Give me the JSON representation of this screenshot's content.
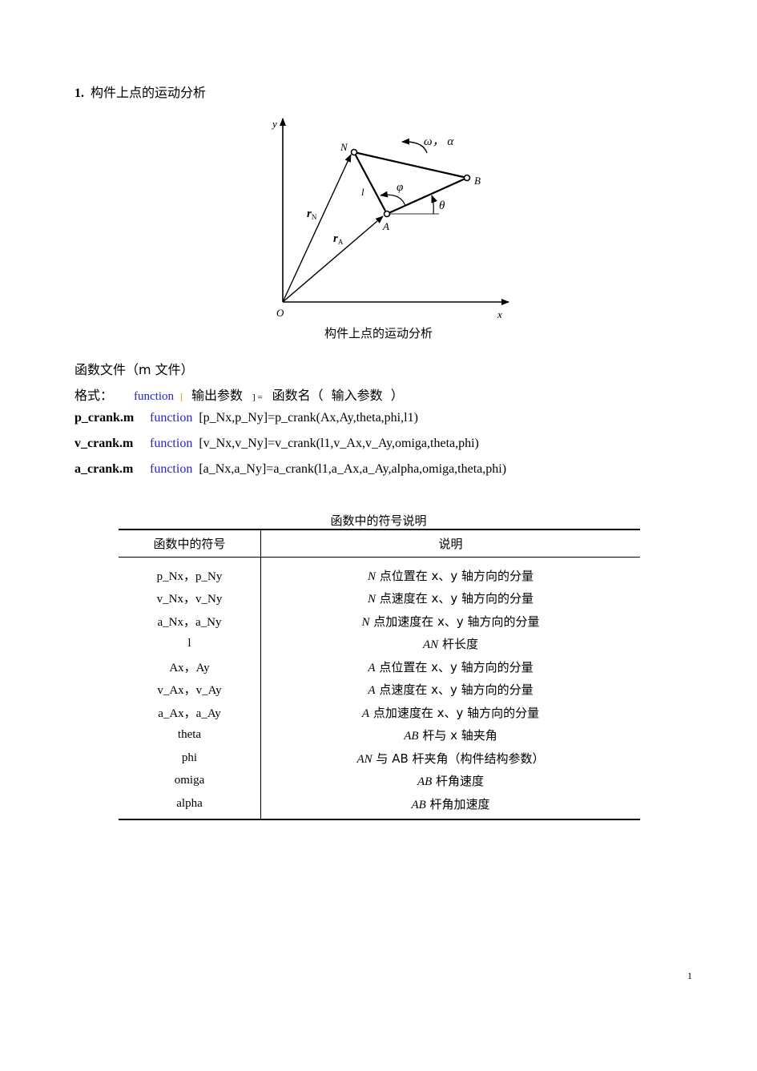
{
  "section": {
    "number": "1.",
    "title": "构件上点的运动分析"
  },
  "figure": {
    "labels": {
      "y_axis": "y",
      "x_axis": "x",
      "origin": "O",
      "point_N": "N",
      "point_A": "A",
      "point_B": "B",
      "omega_alpha": "ω， α",
      "phi": "φ",
      "theta": "θ",
      "length": "l",
      "r_N": "r",
      "r_N_sub": "N",
      "r_A": "r",
      "r_A_sub": "A"
    },
    "caption": "构件上点的运动分析"
  },
  "intro": {
    "file_line": "函数文件（m 文件）",
    "format_label": "格式：",
    "format_keyword": "function",
    "format_lbracket": "[",
    "format_output": "输出参数",
    "format_rbracket_eq": "] =",
    "format_name": "函数名（",
    "format_input": "输入参数",
    "format_close": "）"
  },
  "functions": [
    {
      "file": "p_crank.m",
      "keyword": "function",
      "signature": "[p_Nx,p_Ny]=p_crank(Ax,Ay,theta,phi,l1)"
    },
    {
      "file": "v_crank.m",
      "keyword": "function",
      "signature": "[v_Nx,v_Ny]=v_crank(l1,v_Ax,v_Ay,omiga,theta,phi)"
    },
    {
      "file": "a_crank.m",
      "keyword": "function",
      "signature": "[a_Nx,a_Ny]=a_crank(l1,a_Ax,a_Ay,alpha,omiga,theta,phi)"
    }
  ],
  "table": {
    "title": "函数中的符号说明",
    "headers": [
      "函数中的符号",
      "说明"
    ],
    "rows": [
      {
        "symbol": "p_Nx，p_Ny",
        "desc_em": "N",
        "desc": " 点位置在 x、y 轴方向的分量"
      },
      {
        "symbol": "v_Nx，v_Ny",
        "desc_em": "N",
        "desc": " 点速度在 x、y 轴方向的分量"
      },
      {
        "symbol": "a_Nx，a_Ny",
        "desc_em": "N",
        "desc": " 点加速度在 x、y 轴方向的分量"
      },
      {
        "symbol": "l",
        "desc_em": "AN",
        "desc": " 杆长度"
      },
      {
        "symbol": "Ax，Ay",
        "desc_em": "A",
        "desc": " 点位置在 x、y 轴方向的分量"
      },
      {
        "symbol": "v_Ax，v_Ay",
        "desc_em": "A",
        "desc": " 点速度在 x、y 轴方向的分量"
      },
      {
        "symbol": "a_Ax，a_Ay",
        "desc_em": "A",
        "desc": " 点加速度在 x、y 轴方向的分量"
      },
      {
        "symbol": "theta",
        "desc_em": "AB",
        "desc": " 杆与 x 轴夹角"
      },
      {
        "symbol": "phi",
        "desc_em": "AN",
        "desc": " 与 AB 杆夹角（构件结构参数）"
      },
      {
        "symbol": "omiga",
        "desc_em": "AB",
        "desc": " 杆角速度"
      },
      {
        "symbol": "alpha",
        "desc_em": "AB",
        "desc": " 杆角加速度"
      }
    ]
  },
  "page_number": "1"
}
